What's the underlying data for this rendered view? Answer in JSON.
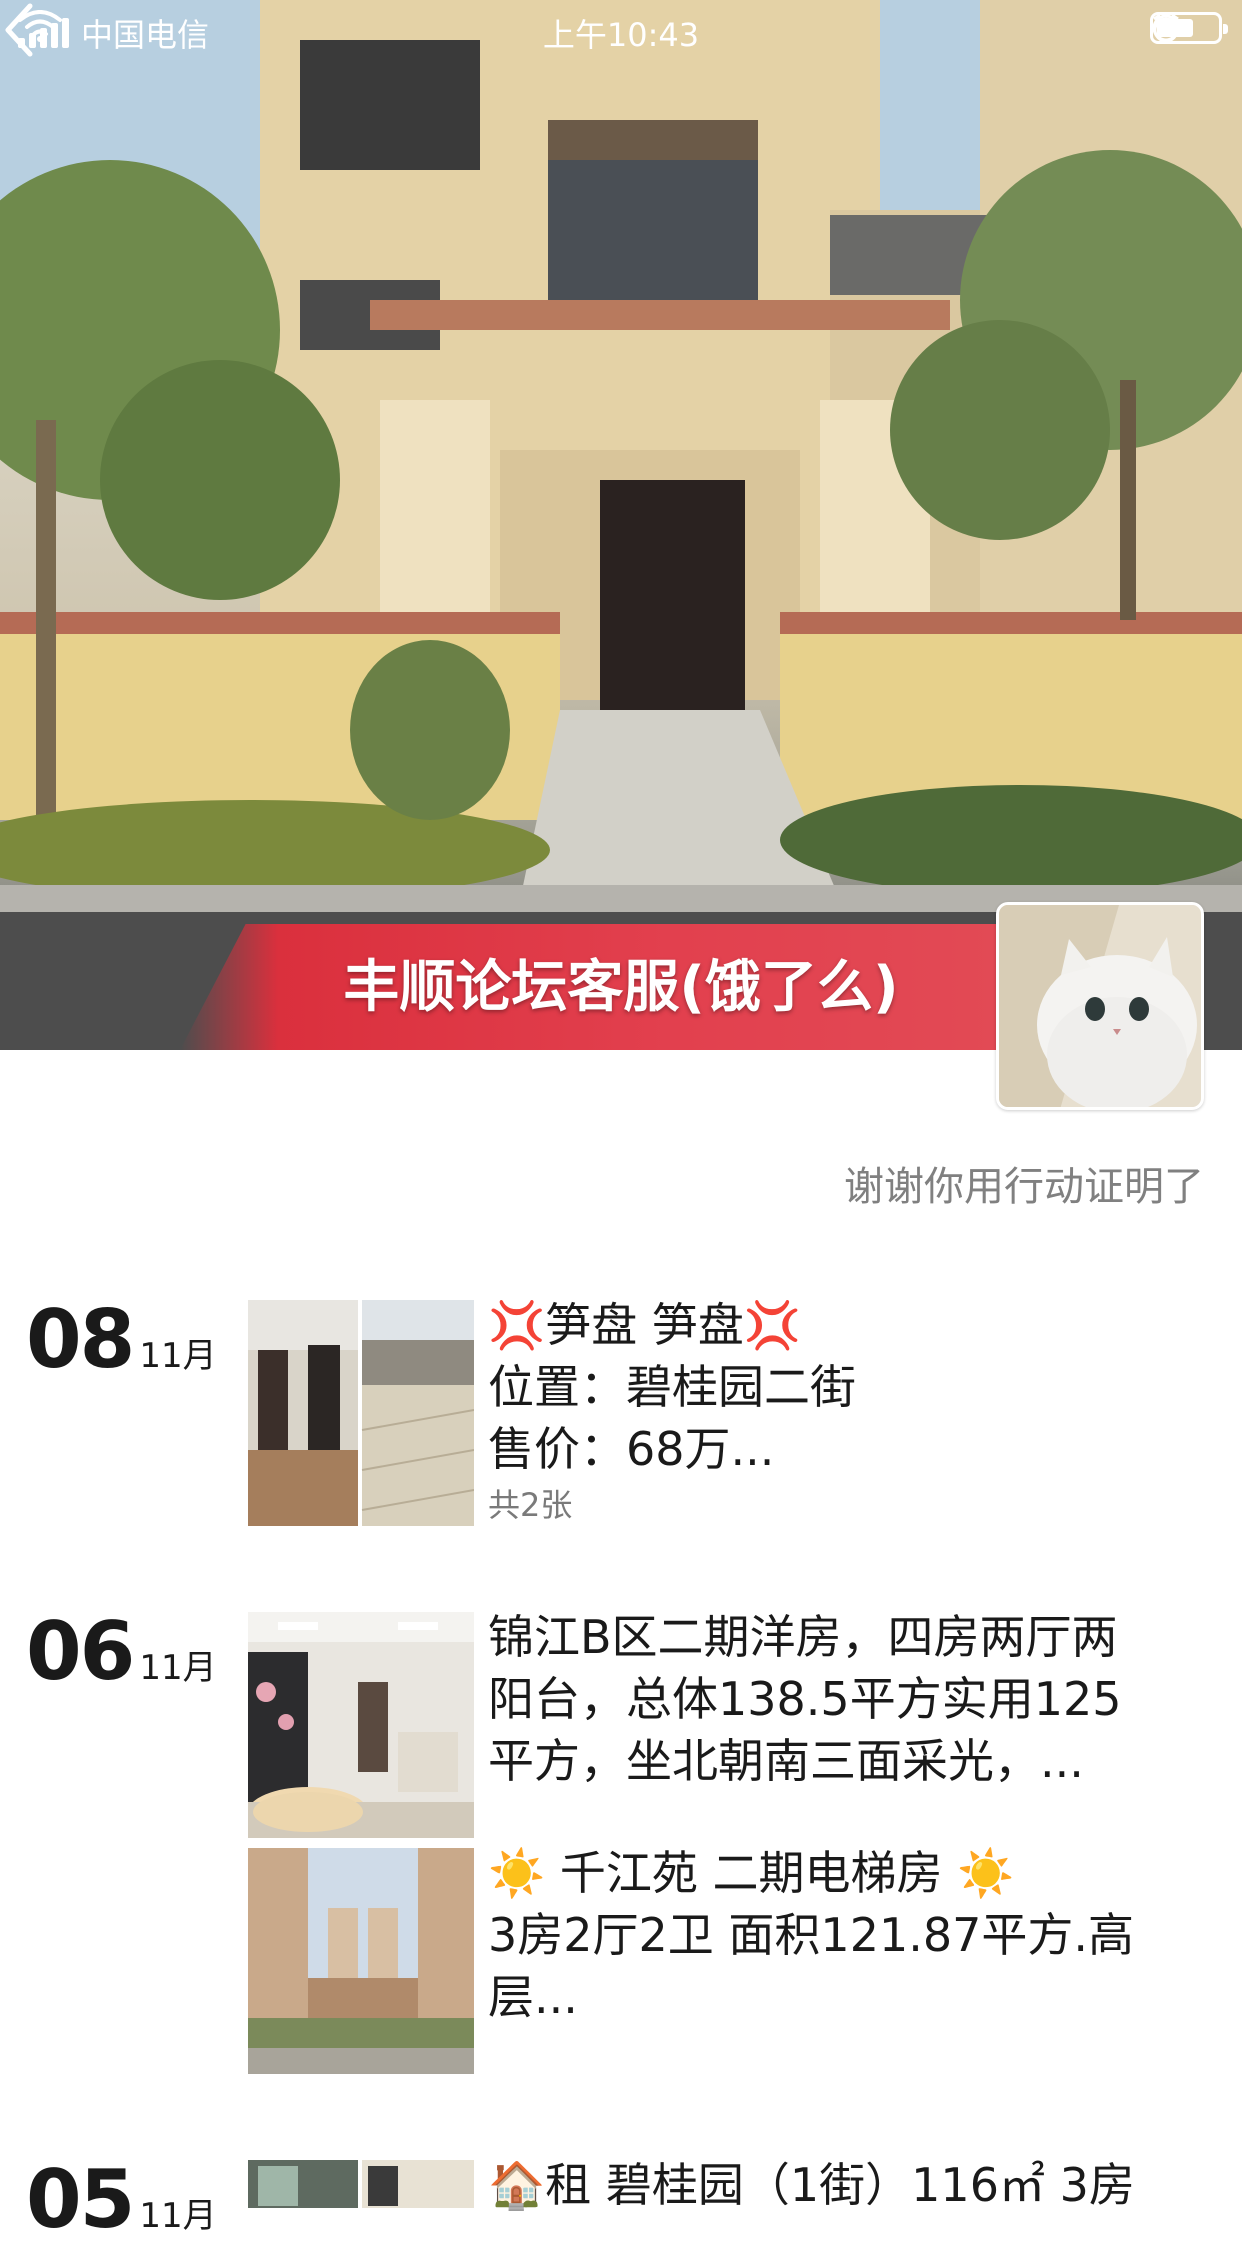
{
  "status_bar": {
    "carrier": "中国电信",
    "time": "上午10:43"
  },
  "cover": {
    "banner_text": "丰顺论坛客服(饿了么)"
  },
  "profile": {
    "signature": "谢谢你用行动证明了"
  },
  "feed": [
    {
      "day": "08",
      "month": "11月",
      "posts": [
        {
          "lines": [
            "💢笋盘 笋盘💢",
            "位置：碧桂园二街",
            "售价：68万..."
          ],
          "photo_count": "共2张"
        }
      ]
    },
    {
      "day": "06",
      "month": "11月",
      "posts": [
        {
          "lines": [
            "锦江B区二期洋房，四房两厅两",
            "阳台，总体138.5平方实用125",
            "平方，坐北朝南三面采光，..."
          ]
        },
        {
          "lines": [
            "☀️ 千江苑 二期电梯房 ☀️",
            "3房2厅2卫  面积121.87平方.高",
            "层..."
          ]
        }
      ]
    },
    {
      "day": "05",
      "month": "11月",
      "posts": [
        {
          "lines": [
            "🏠租 碧桂园（1街）116㎡ 3房"
          ]
        }
      ]
    }
  ],
  "colors": {
    "banner_red": "#e2404e",
    "text_primary": "#1a1a1a",
    "text_secondary": "#808080"
  }
}
